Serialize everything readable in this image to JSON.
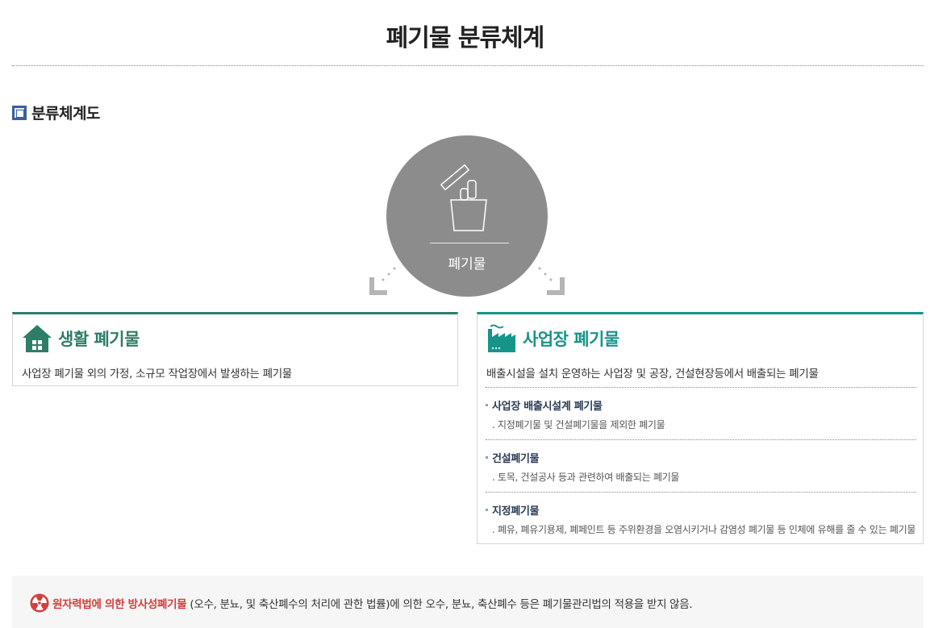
{
  "page": {
    "title": "폐기물 분류체계"
  },
  "section": {
    "title": "분류체계도"
  },
  "diagram": {
    "root_label": "폐기물"
  },
  "household": {
    "title": "생활 폐기물",
    "description": "사업장 폐기물 외의 가정, 소규모 작업장에서 발생하는 폐기물"
  },
  "business": {
    "title": "사업장 폐기물",
    "description": "배출시설을 설치 운영하는 사업장 및 공장, 건설현장등에서 배출되는 폐기물",
    "items": [
      {
        "title": "사업장 배출시설계 폐기물",
        "description": ". 지정폐기물 및 건설폐기물을 제외한 폐기물"
      },
      {
        "title": "건설폐기물",
        "description": ". 토목, 건설공사 등과 관련하여 배출되는 폐기물"
      },
      {
        "title": "지정폐기물",
        "description": ". 폐유, 폐유기용제, 폐페인트 등 주위환경을 오염시키거나 감염성 폐기물 등 인체에 유해를 줄 수 있는 폐기물"
      }
    ]
  },
  "notice": {
    "highlight": "원자력법에 의한 방사성폐기물",
    "text": " (오수, 분뇨, 및 축산폐수의 처리에 관한 법률)에 의한 오수, 분뇨, 축산폐수 등은 폐기물관리법의 적용을 받지 않음."
  },
  "colors": {
    "household_accent": "#2e7d68",
    "business_accent": "#179488",
    "notice_accent": "#d23c3c",
    "circle": "#8c8c8c"
  }
}
